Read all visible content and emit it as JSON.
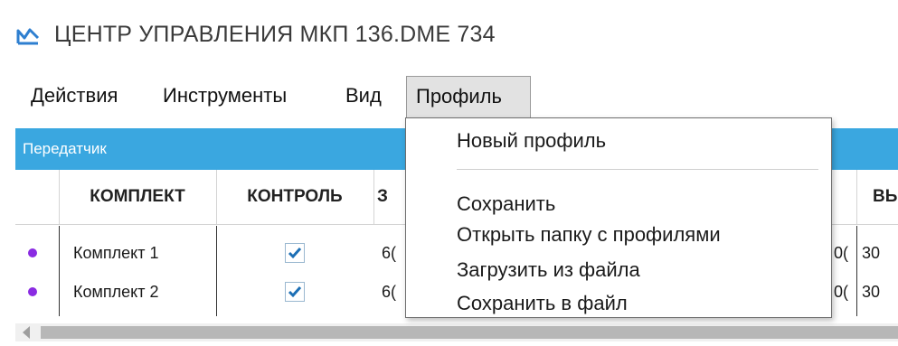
{
  "window": {
    "title": "ЦЕНТР УПРАВЛЕНИЯ  МКП 136.DME 734",
    "app_icon": "chart-line-icon"
  },
  "menubar": {
    "items": [
      {
        "label": "Действия"
      },
      {
        "label": "Инструменты"
      },
      {
        "label": "Вид"
      },
      {
        "label": "Профиль"
      }
    ]
  },
  "panel": {
    "title": "Передатчик"
  },
  "table": {
    "columns": [
      "КОМПЛЕКТ",
      "КОНТРОЛЬ",
      "З",
      "ВЬ"
    ],
    "rows": [
      {
        "name": "Комплект 1",
        "checked": true,
        "col3": "6(",
        "col_partial": "0(",
        "col_last": "30"
      },
      {
        "name": "Комплект 2",
        "checked": true,
        "col3": "6(",
        "col_partial": "0(",
        "col_last": "30"
      }
    ]
  },
  "profile_menu": {
    "items": [
      {
        "label": "Новый профиль"
      },
      {
        "label": "Сохранить"
      },
      {
        "label": "Открыть папку с профилями"
      },
      {
        "label": "Загрузить из файла"
      },
      {
        "label": "Сохранить в файл"
      }
    ]
  },
  "colors": {
    "panel_header": "#3aa7e0",
    "row_dot": "#8a2be2",
    "checkmark": "#1c6fb5",
    "app_icon": "#2e7fd0"
  }
}
